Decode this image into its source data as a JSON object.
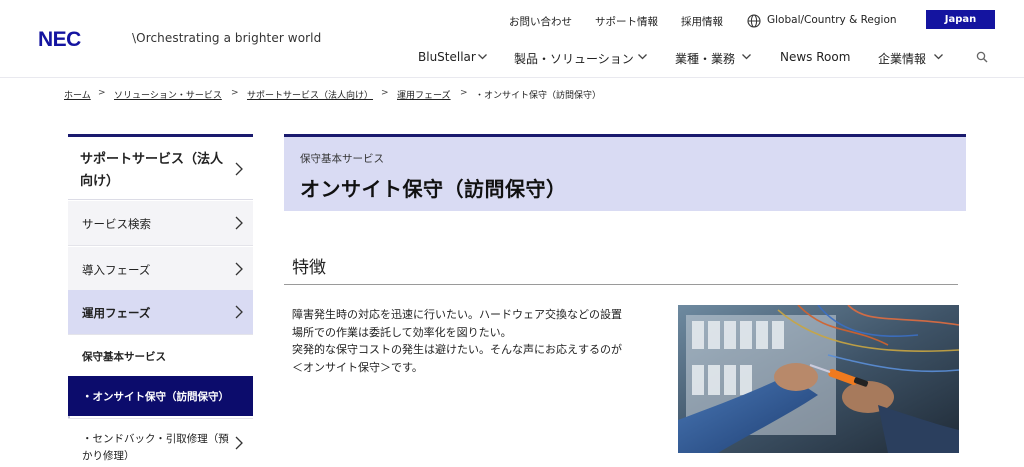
{
  "brand": {
    "logo": "NEC",
    "tagline": "\\Orchestrating a brighter world"
  },
  "utility_nav": [
    "お問い合わせ",
    "サポート情報",
    "採用情報",
    "Global/Country & Region"
  ],
  "region_button": "Japan",
  "main_nav": [
    "BluStellar",
    "製品・ソリューション",
    "業種・業務",
    "News Room",
    "企業情報"
  ],
  "breadcrumb": [
    "ホーム",
    "ソリューション・サービス",
    "サポートサービス（法人向け）",
    "運用フェーズ",
    "・オンサイト保守（訪問保守）"
  ],
  "breadcrumb_separator": ">",
  "sidebar": {
    "heading": "サポートサービス（法人向け）",
    "items": [
      "サービス検索",
      "導入フェーズ",
      "運用フェーズ"
    ],
    "subheading": "保守基本サービス",
    "current": "・オンサイト保守（訪問保守）",
    "next": "・センドバック・引取修理（預かり修理）"
  },
  "page": {
    "category": "保守基本サービス",
    "title": "オンサイト保守（訪問保守）",
    "section_title": "特徴",
    "paragraph_lines": [
      "障害発生時の対応を迅速に行いたい。ハードウェア交換などの設置",
      "場所での作業は委託して効率化を図りたい。",
      "突発的な保守コストの発生は避けたい。そんな声にお応えするのが",
      "＜オンサイト保守＞です。"
    ]
  },
  "colors": {
    "brand_blue": "#1414a0",
    "navy": "#0c0c6c",
    "lavender": "#d9dbf3"
  }
}
